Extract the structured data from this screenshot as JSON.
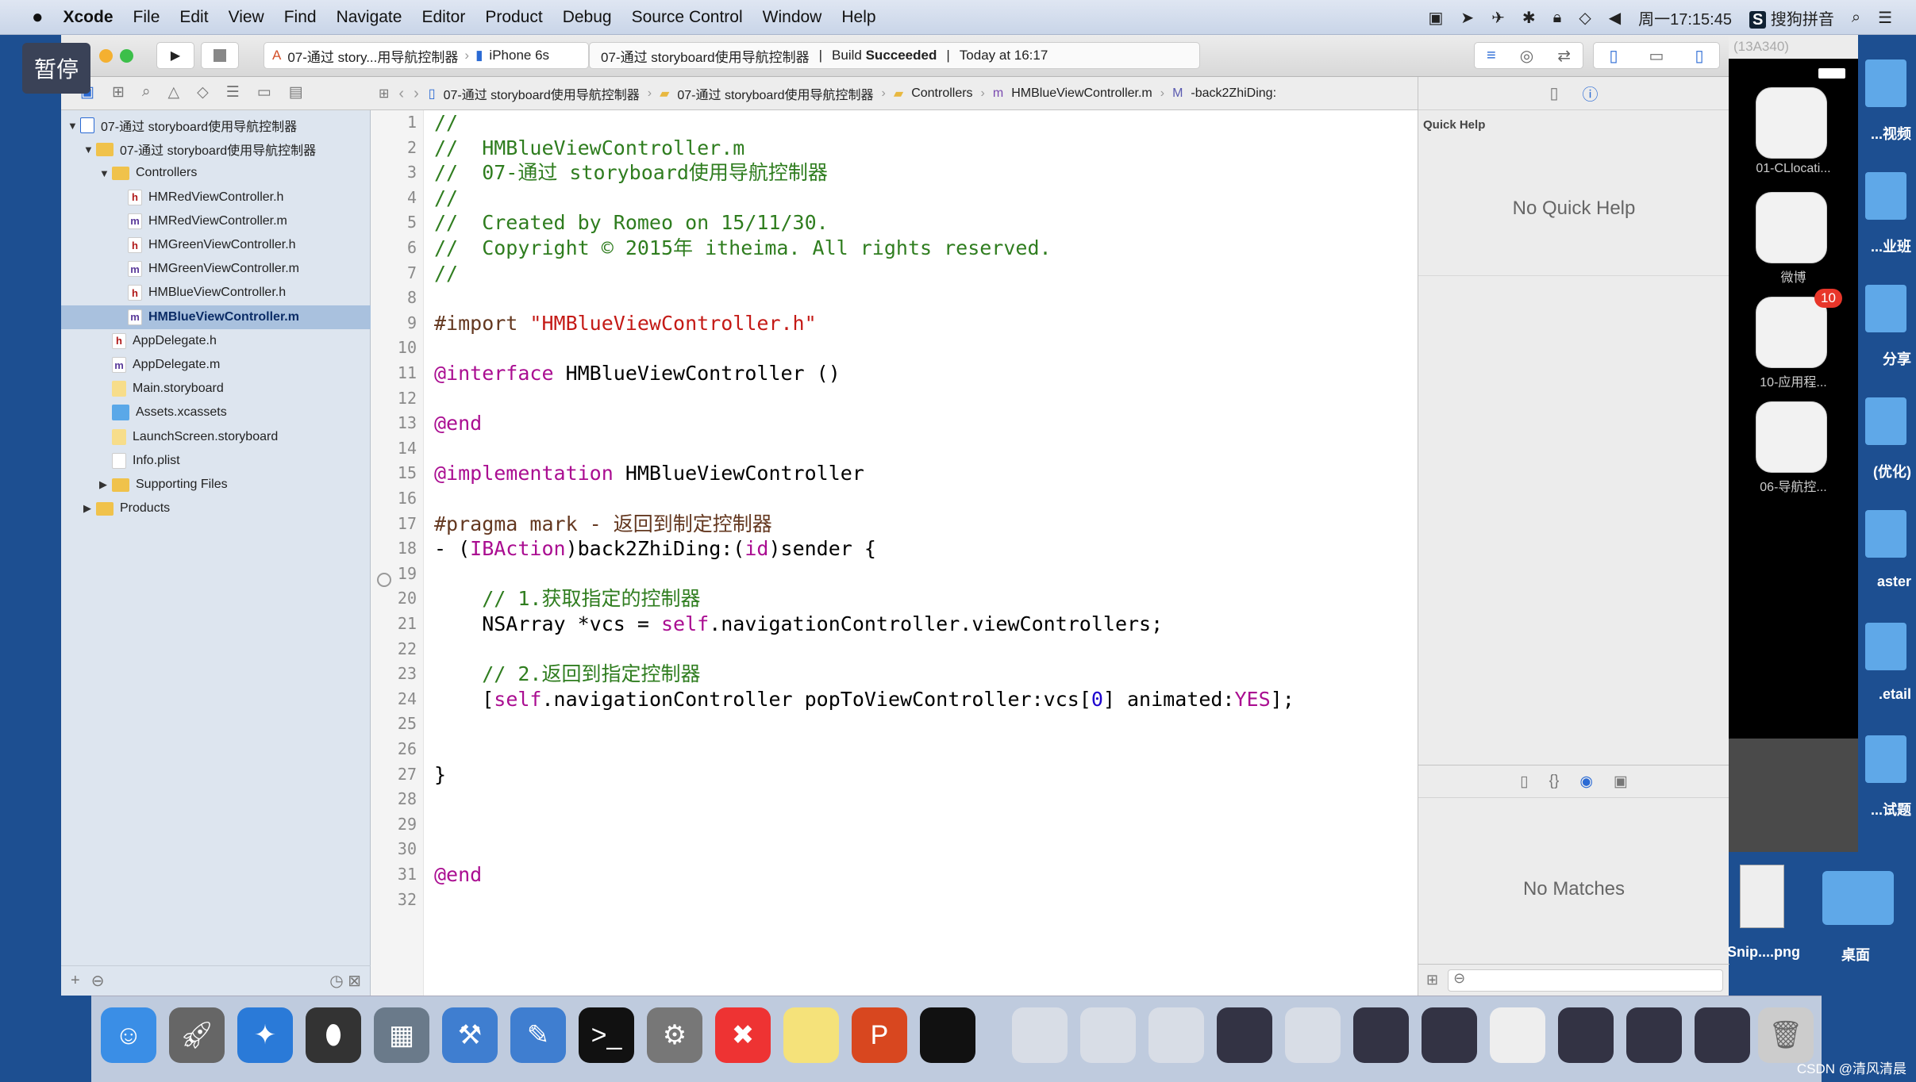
{
  "menubar": {
    "apple": "",
    "app": "Xcode",
    "items": [
      "File",
      "Edit",
      "View",
      "Find",
      "Navigate",
      "Editor",
      "Product",
      "Debug",
      "Source Control",
      "Window",
      "Help"
    ],
    "clock": "周一17:15:45",
    "ime": "搜狗拼音"
  },
  "overlay": {
    "pause": "暂停"
  },
  "toolbar": {
    "scheme": "07-通过 story...用导航控制器",
    "device": "iPhone 6s",
    "activity_project": "07-通过 storyboard使用导航控制器",
    "activity_status_prefix": "Build",
    "activity_status": "Succeeded",
    "activity_time": "Today at 16:17"
  },
  "jumpbar": [
    "07-通过 storyboard使用导航控制器",
    "07-通过 storyboard使用导航控制器",
    "Controllers",
    "HMBlueViewController.m",
    "-back2ZhiDing:"
  ],
  "navigator": {
    "items": [
      {
        "label": "07-通过 storyboard使用导航控制器",
        "type": "project",
        "depth": 0,
        "open": true
      },
      {
        "label": "07-通过 storyboard使用导航控制器",
        "type": "folder",
        "depth": 1,
        "open": true
      },
      {
        "label": "Controllers",
        "type": "folder",
        "depth": 2,
        "open": true
      },
      {
        "label": "HMRedViewController.h",
        "type": "h",
        "depth": 3
      },
      {
        "label": "HMRedViewController.m",
        "type": "m",
        "depth": 3
      },
      {
        "label": "HMGreenViewController.h",
        "type": "h",
        "depth": 3
      },
      {
        "label": "HMGreenViewController.m",
        "type": "m",
        "depth": 3
      },
      {
        "label": "HMBlueViewController.h",
        "type": "h",
        "depth": 3
      },
      {
        "label": "HMBlueViewController.m",
        "type": "m",
        "depth": 3,
        "selected": true
      },
      {
        "label": "AppDelegate.h",
        "type": "h",
        "depth": 2
      },
      {
        "label": "AppDelegate.m",
        "type": "m",
        "depth": 2
      },
      {
        "label": "Main.storyboard",
        "type": "sb",
        "depth": 2
      },
      {
        "label": "Assets.xcassets",
        "type": "assets",
        "depth": 2
      },
      {
        "label": "LaunchScreen.storyboard",
        "type": "sb",
        "depth": 2
      },
      {
        "label": "Info.plist",
        "type": "plist",
        "depth": 2
      },
      {
        "label": "Supporting Files",
        "type": "folder",
        "depth": 2,
        "open": false
      },
      {
        "label": "Products",
        "type": "folder",
        "depth": 1,
        "open": false
      }
    ]
  },
  "syntax_colors": {
    "c": "#2f7d1f",
    "pp": "#643820",
    "str": "#c41a16",
    "kw": "#aa0d91",
    "num": "#1c00cf",
    "pl": "#000000"
  },
  "code": [
    [
      [
        "c",
        "//"
      ]
    ],
    [
      [
        "c",
        "//  HMBlueViewController.m"
      ]
    ],
    [
      [
        "c",
        "//  07-通过 storyboard使用导航控制器"
      ]
    ],
    [
      [
        "c",
        "//"
      ]
    ],
    [
      [
        "c",
        "//  Created by Romeo on 15/11/30."
      ]
    ],
    [
      [
        "c",
        "//  Copyright © 2015年 itheima. All rights reserved."
      ]
    ],
    [
      [
        "c",
        "//"
      ]
    ],
    [],
    [
      [
        "pp",
        "#import "
      ],
      [
        "str",
        "\"HMBlueViewController.h\""
      ]
    ],
    [],
    [
      [
        "kw",
        "@interface"
      ],
      [
        "pl",
        " HMBlueViewController ()"
      ]
    ],
    [],
    [
      [
        "kw",
        "@end"
      ]
    ],
    [],
    [
      [
        "kw",
        "@implementation"
      ],
      [
        "pl",
        " HMBlueViewController"
      ]
    ],
    [],
    [
      [
        "pp",
        "#pragma mark - 返回到制定控制器"
      ]
    ],
    [
      [
        "pl",
        "- ("
      ],
      [
        "kw",
        "IBAction"
      ],
      [
        "pl",
        ")back2ZhiDing:("
      ],
      [
        "kw",
        "id"
      ],
      [
        "pl",
        ")sender {"
      ]
    ],
    [],
    [
      [
        "c",
        "    // 1.获取指定的控制器"
      ]
    ],
    [
      [
        "pl",
        "    NSArray *vcs = "
      ],
      [
        "kw",
        "self"
      ],
      [
        "pl",
        ".navigationController.viewControllers;"
      ]
    ],
    [],
    [
      [
        "c",
        "    // 2.返回到指定控制器"
      ]
    ],
    [
      [
        "pl",
        "    ["
      ],
      [
        "kw",
        "self"
      ],
      [
        "pl",
        ".navigationController popToViewController:vcs["
      ],
      [
        "num",
        "0"
      ],
      [
        "pl",
        "] animated:"
      ],
      [
        "kw",
        "YES"
      ],
      [
        "pl",
        "];"
      ]
    ],
    [],
    [],
    [
      [
        "pl",
        "}"
      ]
    ],
    [],
    [],
    [],
    [
      [
        "kw",
        "@end"
      ]
    ],
    []
  ],
  "inspector": {
    "title": "Quick Help",
    "empty": "No Quick Help",
    "library_empty": "No Matches"
  },
  "simulator": {
    "title": "(13A340)",
    "apps": [
      {
        "label": "01-CLlocati..."
      },
      {
        "label": "微博"
      },
      {
        "label": "10-应用程...",
        "badge": "10"
      },
      {
        "label": "06-导航控..."
      }
    ]
  },
  "desktop": {
    "folders": [
      "...视频",
      "...业班",
      "分享",
      "(优化)",
      "aster",
      ".etail",
      "...试题"
    ],
    "files": [
      {
        "label": "Snip....png"
      },
      {
        "label": "桌面"
      }
    ]
  },
  "watermark": "CSDN @清风清晨"
}
